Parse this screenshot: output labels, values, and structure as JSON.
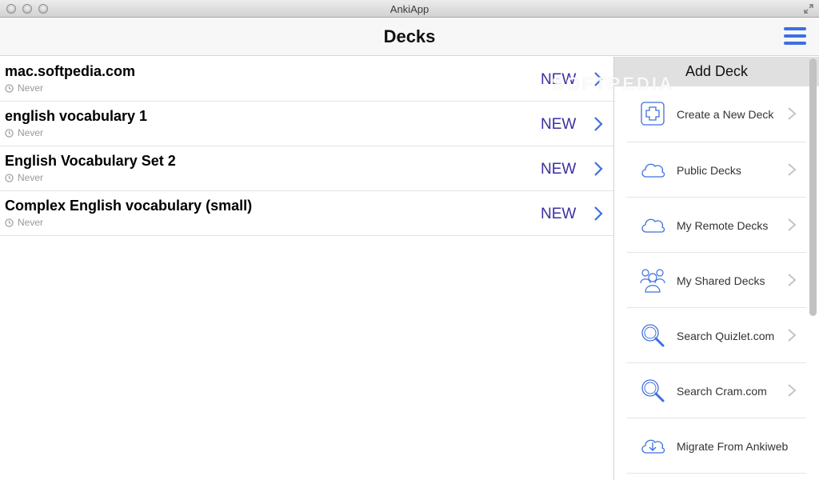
{
  "window": {
    "title": "AnkiApp"
  },
  "header": {
    "title": "Decks"
  },
  "decks": [
    {
      "name": "mac.softpedia.com",
      "last_studied": "Never",
      "status": "NEW"
    },
    {
      "name": "english vocabulary 1",
      "last_studied": "Never",
      "status": "NEW"
    },
    {
      "name": "English Vocabulary Set 2",
      "last_studied": "Never",
      "status": "NEW"
    },
    {
      "name": "Complex English vocabulary (small)",
      "last_studied": "Never",
      "status": "NEW"
    }
  ],
  "add_deck_panel": {
    "title": "Add Deck",
    "items": [
      {
        "label": "Create a New Deck",
        "icon": "plus-square-icon"
      },
      {
        "label": "Public Decks",
        "icon": "cloud-icon"
      },
      {
        "label": "My Remote Decks",
        "icon": "cloud-icon"
      },
      {
        "label": "My Shared Decks",
        "icon": "people-icon"
      },
      {
        "label": "Search Quizlet.com",
        "icon": "magnifier-icon"
      },
      {
        "label": "Search Cram.com",
        "icon": "magnifier-icon"
      },
      {
        "label": "Migrate From Ankiweb",
        "icon": "cloud-download-icon"
      }
    ]
  },
  "watermark": "SOFTPEDIA",
  "colors": {
    "accent": "#3d6fe0",
    "status_text": "#3a2fa0",
    "panel_header_bg": "#e0e0e0"
  }
}
